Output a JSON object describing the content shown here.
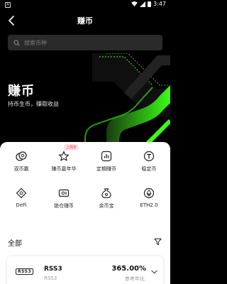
{
  "status_bar": {
    "time": "3:47"
  },
  "header": {
    "title": "赚币"
  },
  "search": {
    "placeholder": "搜索币种"
  },
  "hero": {
    "title": "赚币",
    "subtitle": "持币生币，赚取收益"
  },
  "products": [
    {
      "label": "双币赢",
      "icon": "coins-icon"
    },
    {
      "label": "赚币嘉年华",
      "icon": "star-icon",
      "badge": "上周年"
    },
    {
      "label": "定期赚币",
      "icon": "bar-chart-icon"
    },
    {
      "label": "稳定币",
      "icon": "tether-icon"
    },
    {
      "label": "DeFi",
      "icon": "defi-icon"
    },
    {
      "label": "锁仓赚币",
      "icon": "lock-safe-icon"
    },
    {
      "label": "余币宝",
      "icon": "money-bag-icon"
    },
    {
      "label": "ETH2.0",
      "icon": "ethereum-icon"
    }
  ],
  "list": {
    "section_title": "全部",
    "items": [
      {
        "logo": "RSS3",
        "name": "RSS3",
        "sub": "RSS3",
        "apy": "365.00%",
        "apy_label": "参考年化"
      }
    ]
  },
  "colors": {
    "accent_green": "#39ff14",
    "background": "#000000"
  }
}
